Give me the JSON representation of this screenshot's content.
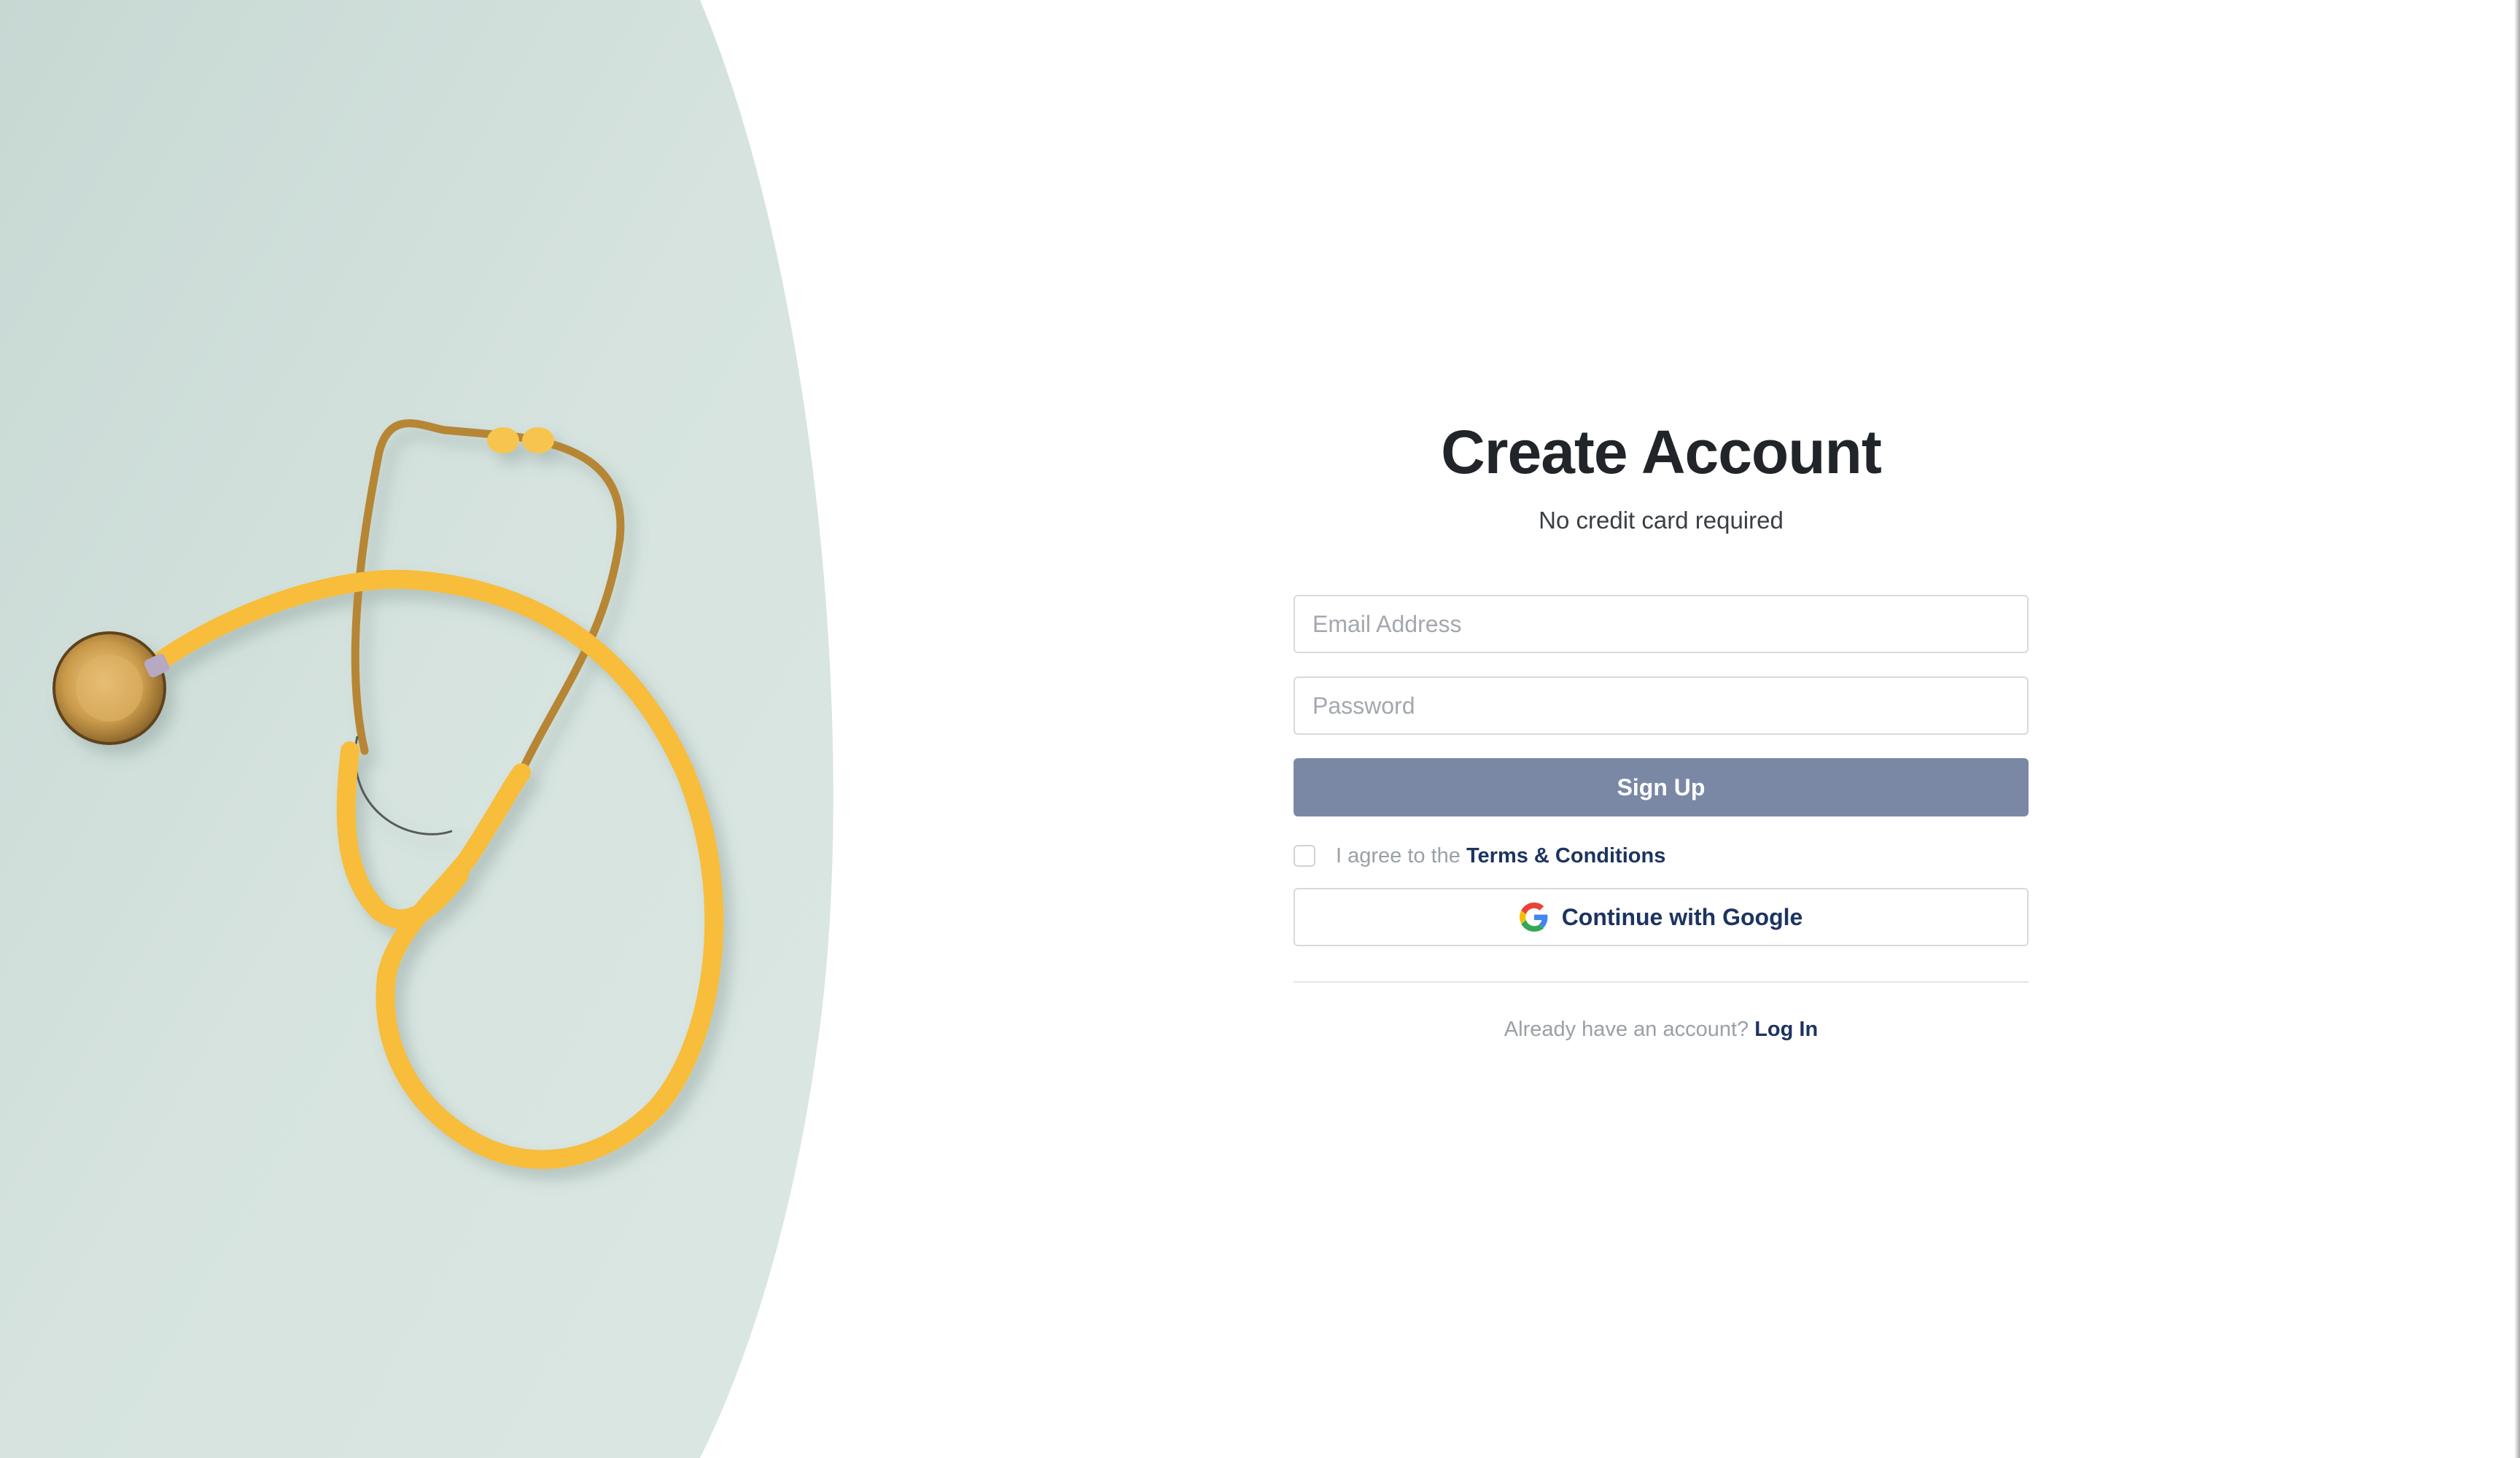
{
  "page": {
    "background": "#ffffff"
  },
  "hero": {
    "image_alt": "Yellow stethoscope on a light mint background",
    "panel_color": "#cfddd8",
    "stethoscope_color": "#f7bd3a"
  },
  "auth": {
    "title": "Create Account",
    "subtitle": "No credit card required",
    "email": {
      "placeholder": "Email Address",
      "value": ""
    },
    "password": {
      "placeholder": "Password",
      "value": ""
    },
    "sign_up_label": "Sign Up",
    "terms": {
      "checked": false,
      "prefix": "I agree to the ",
      "link_label": "Terms & Conditions"
    },
    "google_label": "Continue with Google",
    "footer": {
      "prompt": "Already have an account?",
      "login_label": "Log In"
    }
  },
  "colors": {
    "primary_button": "#7a88a6",
    "link": "#1d3461",
    "muted_text": "#9aa0a8",
    "border": "#d6d9de"
  },
  "icons": {
    "google": "google-icon",
    "stethoscope": "stethoscope-image"
  }
}
